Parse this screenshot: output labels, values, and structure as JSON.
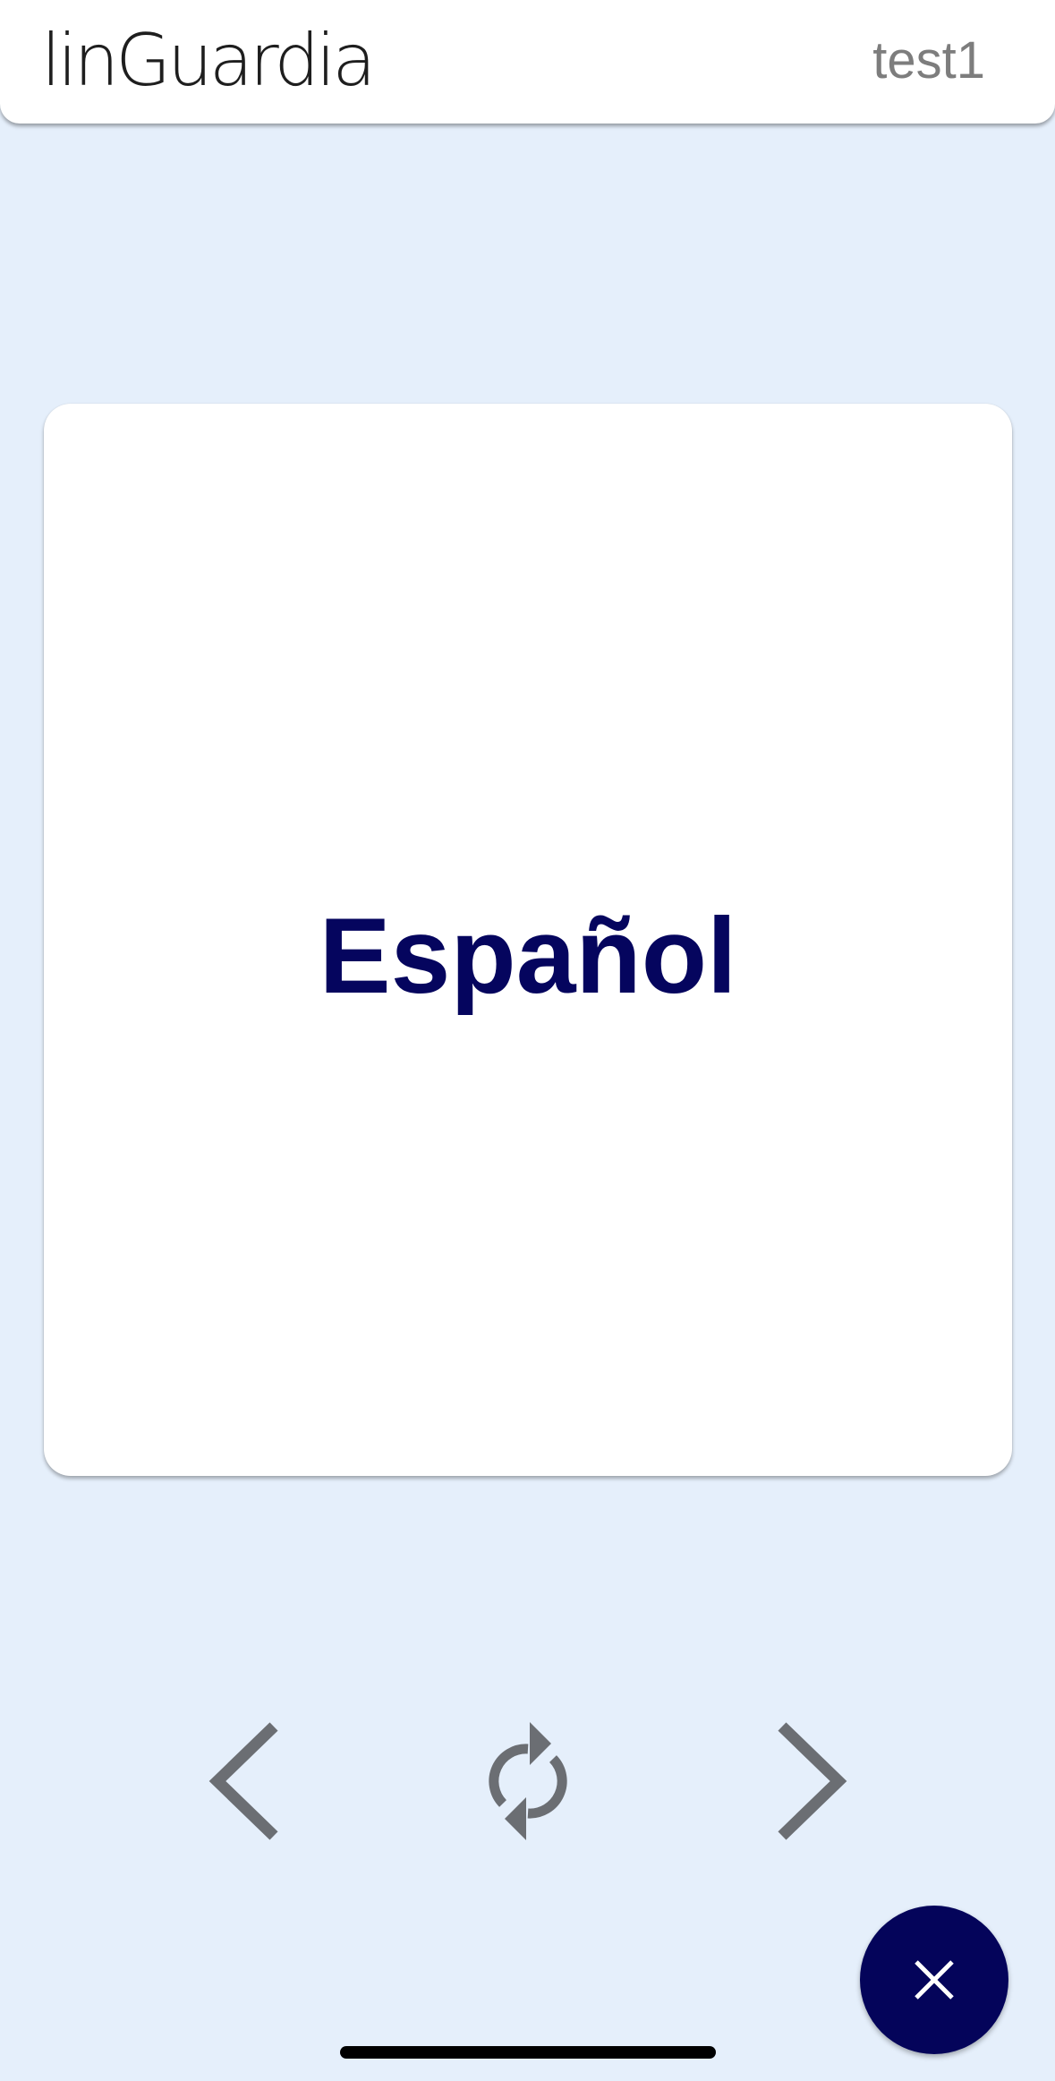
{
  "app": {
    "logo_text": "linGuardia",
    "user_name": "test1"
  },
  "card": {
    "word": "Español"
  },
  "controls": {
    "prev_icon": "chevron-left-icon",
    "flip_icon": "refresh-icon",
    "next_icon": "chevron-right-icon",
    "close_icon": "close-icon"
  },
  "colors": {
    "background": "#e5effb",
    "card_text": "#05055e",
    "fab": "#04045a",
    "icon_gray": "#6b6e73"
  }
}
